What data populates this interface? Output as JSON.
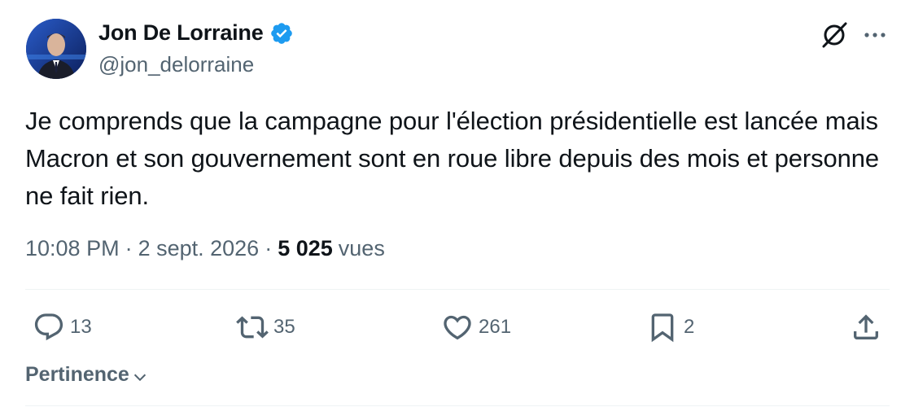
{
  "author": {
    "display_name": "Jon De Lorraine",
    "handle": "@jon_delorraine",
    "verified": true,
    "verified_color": "#1d9bf0"
  },
  "tweet": {
    "text": "Je comprends que la campagne pour l'élection présidentielle est lancée mais Macron et son gouvernement sont en roue libre depuis des mois et personne ne fait rien.",
    "time": "10:08 PM",
    "date": "2 sept. 2026",
    "views_count": "5 025",
    "views_label": "vues"
  },
  "actions": {
    "replies": "13",
    "reposts": "35",
    "likes": "261",
    "bookmarks": "2"
  },
  "header_icons": [
    "grok-icon",
    "more-icon"
  ],
  "action_icons": [
    "reply-icon",
    "repost-icon",
    "like-icon",
    "bookmark-icon",
    "share-icon"
  ],
  "sort": {
    "label": "Pertinence"
  },
  "colors": {
    "text_primary": "#0f1419",
    "text_secondary": "#536471",
    "divider": "#eff3f4"
  }
}
